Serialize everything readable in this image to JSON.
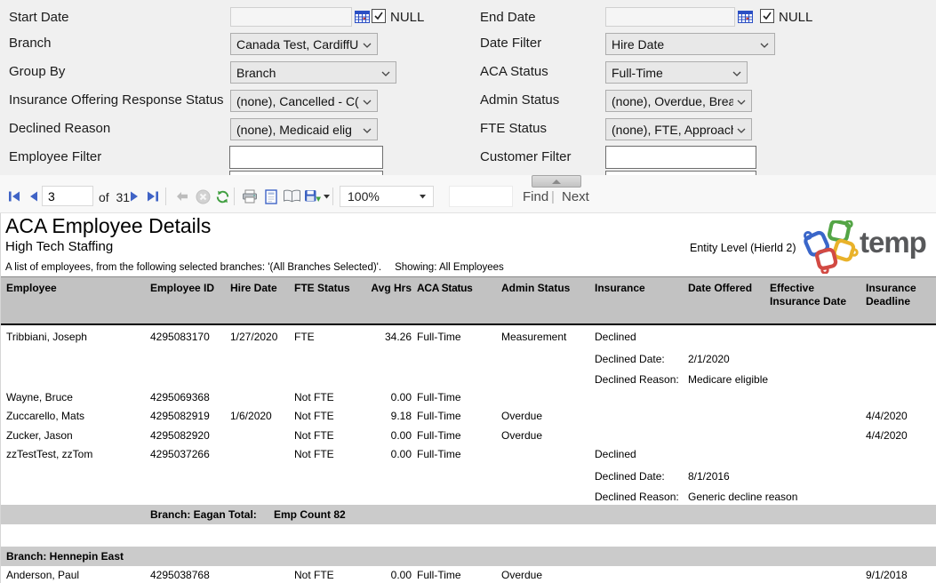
{
  "params": {
    "start_date": {
      "label": "Start Date",
      "value": "",
      "null_label": "NULL"
    },
    "end_date": {
      "label": "End Date",
      "value": "",
      "null_label": "NULL"
    },
    "branch": {
      "label": "Branch",
      "value": "Canada Test, CardiffU"
    },
    "date_filter": {
      "label": "Date Filter",
      "value": "Hire Date"
    },
    "group_by": {
      "label": "Group By",
      "value": "Branch"
    },
    "aca_status": {
      "label": "ACA Status",
      "value": "Full-Time"
    },
    "insurance_offering": {
      "label": "Insurance Offering Response Status",
      "value": "(none), Cancelled - C("
    },
    "admin_status": {
      "label": "Admin Status",
      "value": "(none), Overdue, Brea"
    },
    "declined_reason": {
      "label": "Declined Reason",
      "value": "(none), Medicaid elig"
    },
    "fte_status": {
      "label": "FTE Status",
      "value": "(none), FTE, Approach"
    },
    "employee_filter": {
      "label": "Employee Filter",
      "value": ""
    },
    "customer_filter": {
      "label": "Customer Filter",
      "value": ""
    }
  },
  "toolbar": {
    "current_page": "3",
    "of_label": "of",
    "total_pages": "31",
    "zoom_level": "100%",
    "find_label": "Find",
    "separator": "|",
    "next_label": "Next"
  },
  "report": {
    "title": "ACA Employee Details",
    "subtitle": "High Tech Staffing",
    "entity_level": "Entity Level (Hierld 2)",
    "logo_text": "temp",
    "description": "A list of employees, from the following selected branches: '(All Branches Selected)'.",
    "showing": "Showing: All Employees",
    "columns": [
      "Employee",
      "Employee ID",
      "Hire Date",
      "FTE Status",
      "Avg Hrs",
      "ACA Status",
      "Admin Status",
      "Insurance",
      "Date Offered",
      "Effective Insurance Date",
      "Insurance Deadline"
    ],
    "rows": [
      {
        "employee": "Tribbiani, Joseph",
        "employee_id": "4295083170",
        "hire_date": "1/27/2020",
        "fte_status": "FTE",
        "avg_hrs": "34.26",
        "aca_status": "Full-Time",
        "admin_status": "Measurement",
        "insurance": "Declined"
      },
      {
        "label": "Declined Date:",
        "value": "2/1/2020"
      },
      {
        "label": "Declined Reason:",
        "value": "Medicare eligible"
      },
      {
        "employee": "Wayne, Bruce",
        "employee_id": "4295069368",
        "fte_status": "Not FTE",
        "avg_hrs": "0.00",
        "aca_status": "Full-Time"
      },
      {
        "employee": "Zuccarello, Mats",
        "employee_id": "4295082919",
        "hire_date": "1/6/2020",
        "fte_status": "Not FTE",
        "avg_hrs": "9.18",
        "aca_status": "Full-Time",
        "admin_status": "Overdue",
        "insurance_deadline": "4/4/2020"
      },
      {
        "employee": "Zucker, Jason",
        "employee_id": "4295082920",
        "fte_status": "Not FTE",
        "avg_hrs": "0.00",
        "aca_status": "Full-Time",
        "admin_status": "Overdue",
        "insurance_deadline": "4/4/2020"
      },
      {
        "employee": "zzTestTest, zzTom",
        "employee_id": "4295037266",
        "fte_status": "Not FTE",
        "avg_hrs": "0.00",
        "aca_status": "Full-Time",
        "insurance": "Declined"
      },
      {
        "label": "Declined Date:",
        "value": "8/1/2016"
      },
      {
        "label": "Declined Reason:",
        "value": "Generic decline reason"
      },
      {
        "group_total_label": "Branch: Eagan Total:",
        "group_total_value": "Emp Count 82"
      },
      {
        "group_header": "Branch: Hennepin East"
      },
      {
        "employee": "Anderson, Paul",
        "employee_id": "4295038768",
        "fte_status": "Not FTE",
        "avg_hrs": "0.00",
        "aca_status": "Full-Time",
        "admin_status": "Overdue",
        "insurance_deadline": "9/1/2018"
      }
    ]
  }
}
